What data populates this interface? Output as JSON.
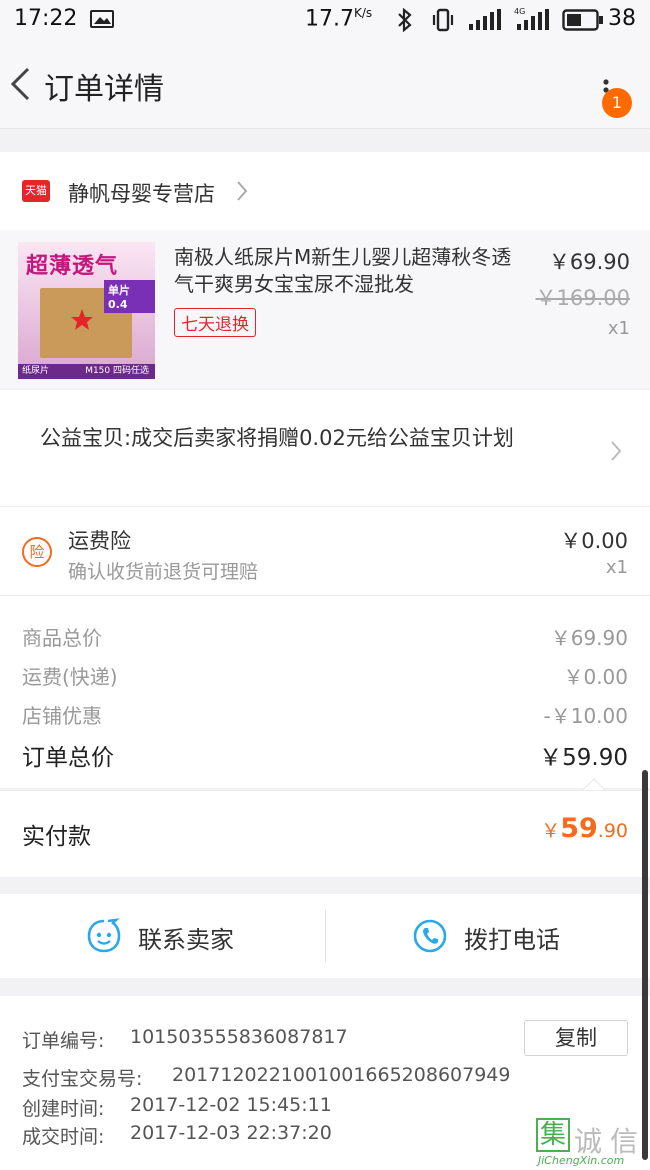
{
  "status_bar": {
    "time": "17:22",
    "speed": "17.7",
    "speed_unit": "K/s",
    "battery": "38"
  },
  "header": {
    "title": "订单详情",
    "badge_count": "1"
  },
  "shop": {
    "tmall_tag": "天猫",
    "name": "静帆母婴专营店"
  },
  "product": {
    "image_banner": "超薄透气",
    "image_tag": "单片 0.4",
    "image_footer_left": "纸尿片",
    "image_footer_right": "M150 四码任选",
    "title": "南极人纸尿片M新生儿婴儿超薄秋冬透气干爽男女宝宝尿不湿批发",
    "service_tag": "七天退换",
    "price": "￥69.90",
    "original_price": "￥169.00",
    "quantity": "x1"
  },
  "charity": {
    "text": "公益宝贝:成交后卖家将捐赠0.02元给公益宝贝计划"
  },
  "insurance": {
    "icon_char": "险",
    "title": "运费险",
    "subtitle": "确认收货前退货可理赔",
    "price": "￥0.00",
    "quantity": "x1"
  },
  "summary": {
    "rows": [
      {
        "label": "商品总价",
        "value": "￥69.90"
      },
      {
        "label": "运费(快递)",
        "value": "￥0.00"
      },
      {
        "label": "店铺优惠",
        "value": "-￥10.00"
      }
    ],
    "total_label": "订单总价",
    "total_value": "￥59.90",
    "paid_label": "实付款",
    "paid_currency": "￥",
    "paid_int": "59",
    "paid_dec": ".90"
  },
  "actions": {
    "contact_label": "联系卖家",
    "call_label": "拨打电话"
  },
  "order_info": {
    "order_no_label": "订单编号:",
    "order_no": "101503555836087817",
    "copy_label": "复制",
    "alipay_label": "支付宝交易号:",
    "alipay_no": "2017120221001001665208607949",
    "created_label": "创建时间:",
    "created_time": "2017-12-02 15:45:11",
    "done_label": "成交时间:",
    "done_time": "2017-12-03 22:37:20"
  },
  "watermark": {
    "char1": "集",
    "char2": "诚",
    "char3": "信",
    "url": "JiChengXin.com"
  },
  "colors": {
    "accent_orange": "#ff6a00",
    "paid_orange": "#f36b1c",
    "tmall_red": "#e4262a",
    "link_blue": "#2aa8e8"
  }
}
